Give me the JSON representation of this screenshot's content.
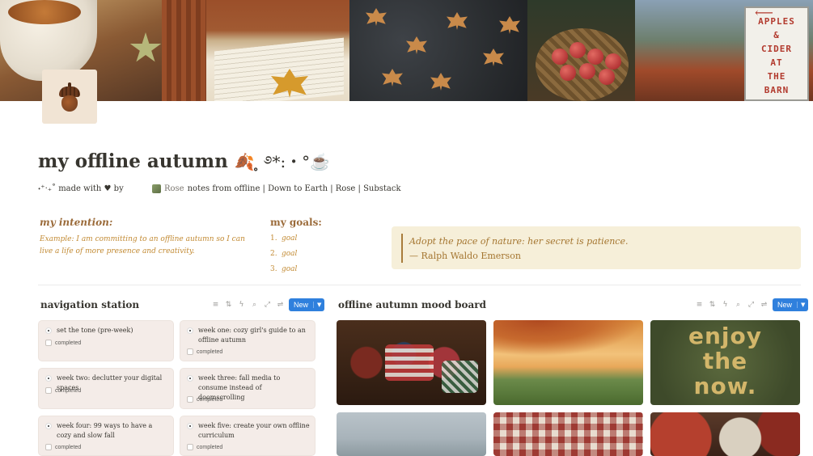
{
  "page": {
    "title": "my offline autumn",
    "title_deco": "🍂 ̥̥ ࿔*:・°☕",
    "icon": "acorn-icon"
  },
  "cover": {
    "sign_text": "APPLES\n&\nCIDER\nAT\nTHE\nBARN"
  },
  "byline": {
    "made_with": "˖⁺‧₊˚ made with ♥ by",
    "author_icon": "rose-avatar-icon",
    "author": "Rose",
    "links": "notes from offline | Down to Earth  | Rose | Substack"
  },
  "intention": {
    "heading": "my intention:",
    "text": "Example: I am committing to an offline autumn so I can live a life of more presence and creativity."
  },
  "goals": {
    "heading": "my goals:",
    "items": [
      {
        "num": "1.",
        "text": "goal"
      },
      {
        "num": "2.",
        "text": "goal"
      },
      {
        "num": "3.",
        "text": "goal"
      }
    ]
  },
  "quote": {
    "text": "Adopt the pace of nature: her secret is patience.",
    "author": "— Ralph Waldo Emerson"
  },
  "navigation": {
    "title": "navigation station",
    "new_label": "New",
    "toolbar_icons": [
      "filter-icon",
      "sort-icon",
      "lightning-icon",
      "search-icon",
      "expand-icon",
      "settings-icon"
    ],
    "cards": [
      {
        "title": "set the tone (pre-week)",
        "status": "completed"
      },
      {
        "title": "week one: cozy girl's guide to an offline autumn",
        "status": "completed"
      },
      {
        "title": "week two: declutter your digital spaces",
        "status": "completed"
      },
      {
        "title": "week three: fall media to consume instead of doomscrolling",
        "status": "completed"
      },
      {
        "title": "week four: 99 ways to have a cozy and slow fall",
        "status": "completed"
      },
      {
        "title": "week five: create your own offline curriculum",
        "status": "completed"
      }
    ]
  },
  "moodboard": {
    "title": "offline autumn mood board",
    "new_label": "New",
    "tile3_text": "enjoy\nthe\nnow."
  },
  "colors": {
    "accent_blue": "#2f80dd",
    "heading_brown": "#9b6b3a",
    "text_gold": "#c28a33",
    "quote_bg": "#f6efd9",
    "card_bg": "#f4ece8"
  }
}
